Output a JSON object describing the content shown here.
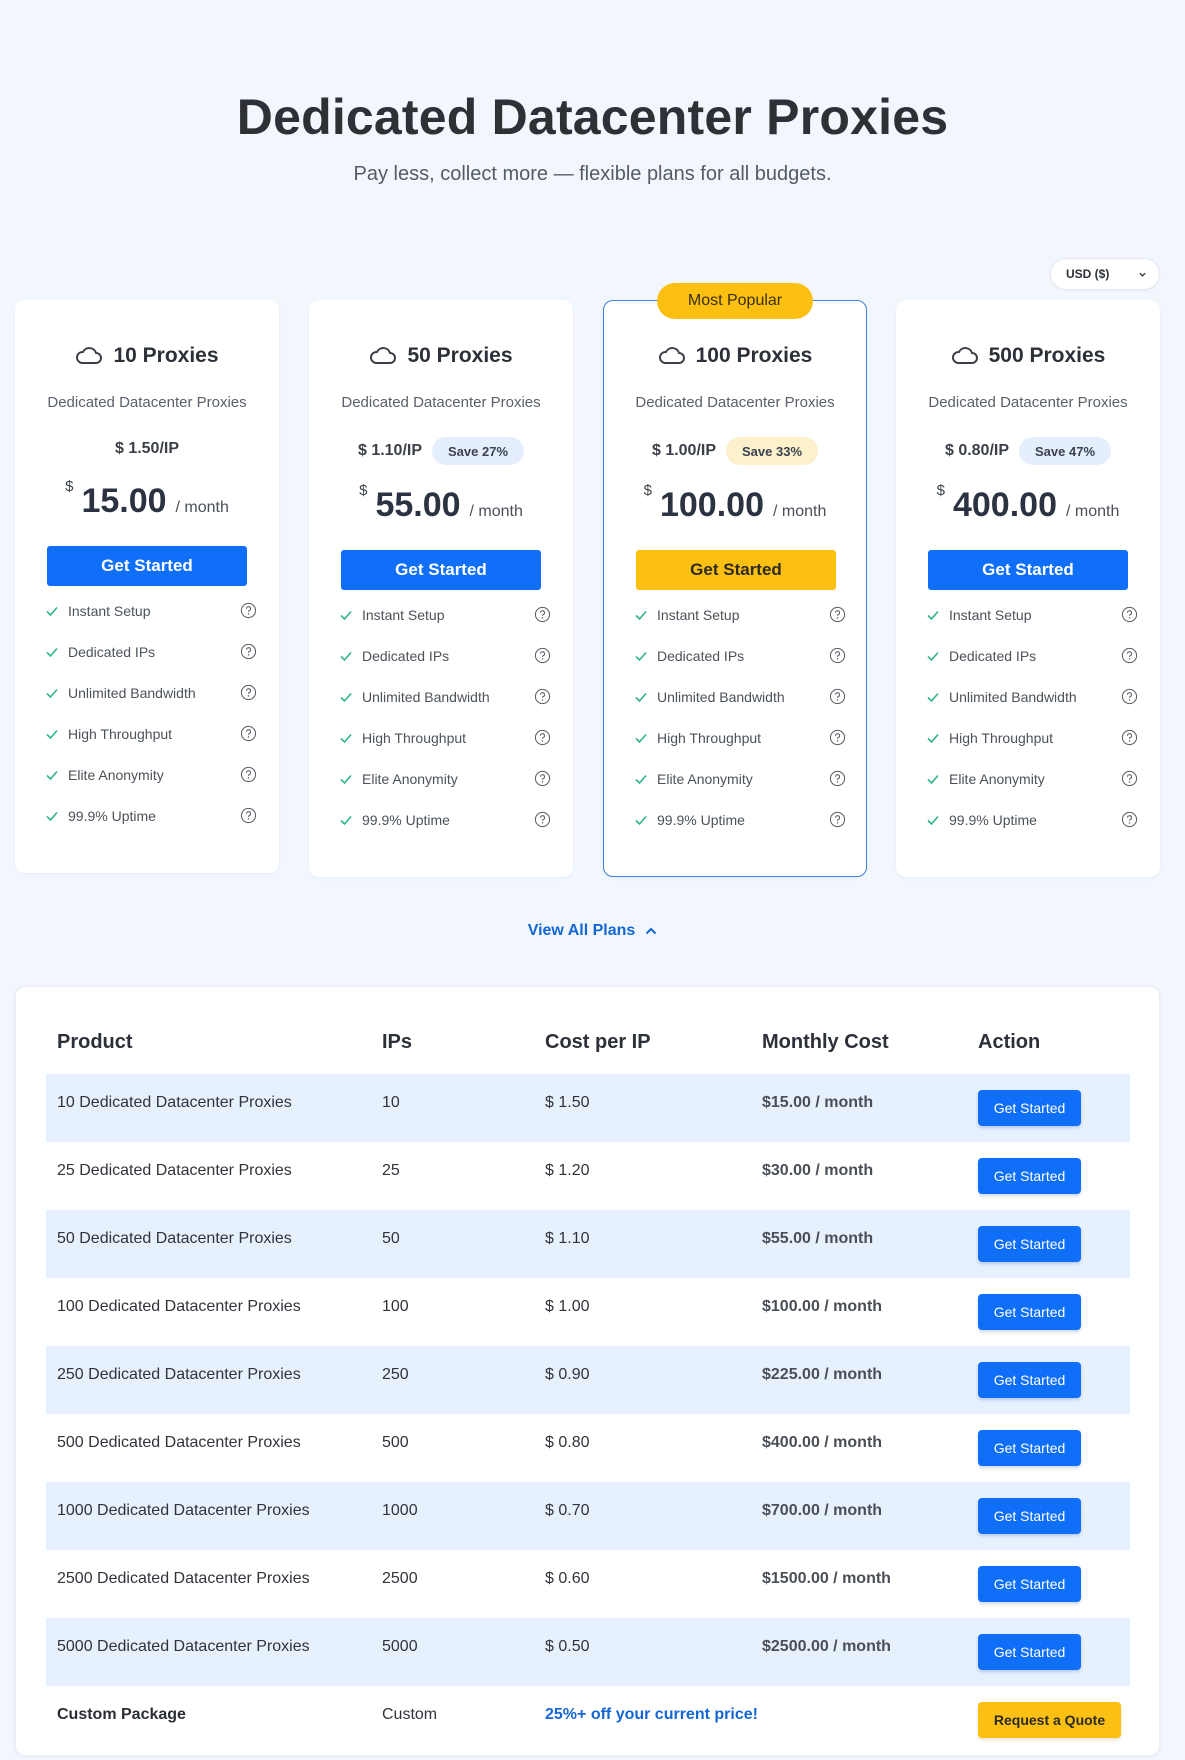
{
  "header": {
    "title": "Dedicated Datacenter Proxies",
    "subtitle": "Pay less, collect more — flexible plans for all budgets."
  },
  "currency": {
    "selected": "USD ($)"
  },
  "popular_badge": "Most Popular",
  "plans": [
    {
      "title": "10 Proxies",
      "subtitle": "Dedicated Datacenter Proxies",
      "price_per_ip": "$ 1.50/IP",
      "save": "",
      "currency_symbol": "$",
      "amount": "15.00",
      "per": "/ month",
      "button": "Get Started"
    },
    {
      "title": "50 Proxies",
      "subtitle": "Dedicated Datacenter Proxies",
      "price_per_ip": "$ 1.10/IP",
      "save": "Save 27%",
      "currency_symbol": "$",
      "amount": "55.00",
      "per": "/ month",
      "button": "Get Started"
    },
    {
      "title": "100 Proxies",
      "subtitle": "Dedicated Datacenter Proxies",
      "price_per_ip": "$ 1.00/IP",
      "save": "Save 33%",
      "currency_symbol": "$",
      "amount": "100.00",
      "per": "/ month",
      "button": "Get Started"
    },
    {
      "title": "500 Proxies",
      "subtitle": "Dedicated Datacenter Proxies",
      "price_per_ip": "$ 0.80/IP",
      "save": "Save 47%",
      "currency_symbol": "$",
      "amount": "400.00",
      "per": "/ month",
      "button": "Get Started"
    }
  ],
  "features": [
    "Instant Setup",
    "Dedicated IPs",
    "Unlimited Bandwidth",
    "High Throughput",
    "Elite Anonymity",
    "99.9% Uptime"
  ],
  "view_all": "View All Plans",
  "table": {
    "headers": [
      "Product",
      "IPs",
      "Cost per IP",
      "Monthly Cost",
      "Action"
    ],
    "rows": [
      {
        "product": "10 Dedicated Datacenter Proxies",
        "ips": "10",
        "cost": "$ 1.50",
        "monthly": "$15.00 / month",
        "action": "Get Started"
      },
      {
        "product": "25 Dedicated Datacenter Proxies",
        "ips": "25",
        "cost": "$ 1.20",
        "monthly": "$30.00 / month",
        "action": "Get Started"
      },
      {
        "product": "50 Dedicated Datacenter Proxies",
        "ips": "50",
        "cost": "$ 1.10",
        "monthly": "$55.00 / month",
        "action": "Get Started"
      },
      {
        "product": "100 Dedicated Datacenter Proxies",
        "ips": "100",
        "cost": "$ 1.00",
        "monthly": "$100.00 / month",
        "action": "Get Started"
      },
      {
        "product": "250 Dedicated Datacenter Proxies",
        "ips": "250",
        "cost": "$ 0.90",
        "monthly": "$225.00 / month",
        "action": "Get Started"
      },
      {
        "product": "500 Dedicated Datacenter Proxies",
        "ips": "500",
        "cost": "$ 0.80",
        "monthly": "$400.00 / month",
        "action": "Get Started"
      },
      {
        "product": "1000 Dedicated Datacenter Proxies",
        "ips": "1000",
        "cost": "$ 0.70",
        "monthly": "$700.00 / month",
        "action": "Get Started"
      },
      {
        "product": "2500 Dedicated Datacenter Proxies",
        "ips": "2500",
        "cost": "$ 0.60",
        "monthly": "$1500.00 / month",
        "action": "Get Started"
      },
      {
        "product": "5000 Dedicated Datacenter Proxies",
        "ips": "5000",
        "cost": "$ 0.50",
        "monthly": "$2500.00 / month",
        "action": "Get Started"
      }
    ],
    "custom": {
      "product": "Custom Package",
      "ips": "Custom",
      "cost": "25%+ off your current price!",
      "action": "Request a Quote"
    }
  },
  "colors": {
    "primary": "#0f6ff8",
    "accent": "#fcc012",
    "background": "#f2f7fd",
    "check": "#2fb38a",
    "link": "#1467d3"
  }
}
